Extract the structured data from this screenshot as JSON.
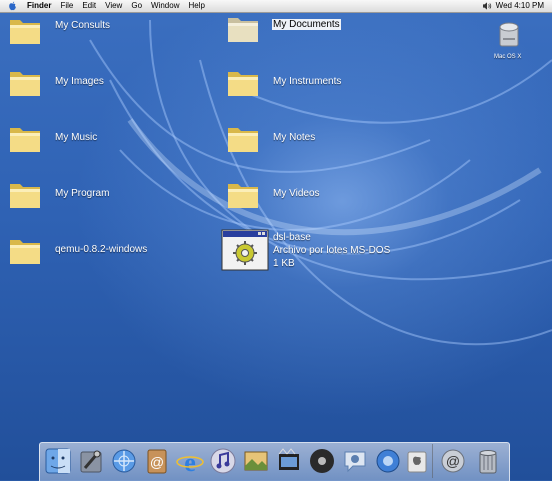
{
  "menubar": {
    "items": [
      "Finder",
      "File",
      "Edit",
      "View",
      "Go",
      "Window",
      "Help"
    ],
    "clock": "Wed 4:10 PM"
  },
  "desktop_icons": {
    "my_consults": "My Consults",
    "my_documents": "My Documents",
    "my_images": "My Images",
    "my_instruments": "My Instruments",
    "my_music": "My Music",
    "my_notes": "My Notes",
    "my_program": "My Program",
    "my_videos": "My Videos",
    "qemu": "qemu-0.8.2-windows",
    "dsl_base": {
      "name": "dsl-base",
      "type": "Archivo por lotes MS-DOS",
      "size": "1 KB"
    }
  },
  "disk": {
    "label": "Mac OS X"
  },
  "dock": {
    "items": [
      "finder-icon",
      "system-preferences-icon",
      "internet-connect-icon",
      "address-book-icon",
      "internet-explorer-icon",
      "itunes-icon",
      "iphoto-icon",
      "imovie-icon",
      "idvd-icon",
      "ichat-icon",
      "quicktime-icon",
      "apple-store-icon",
      "mail-icon",
      "trash-icon"
    ]
  },
  "colors": {
    "desktop": "#2f62b4",
    "folder": "#f2dc8a",
    "selection": "#eef2f8"
  }
}
